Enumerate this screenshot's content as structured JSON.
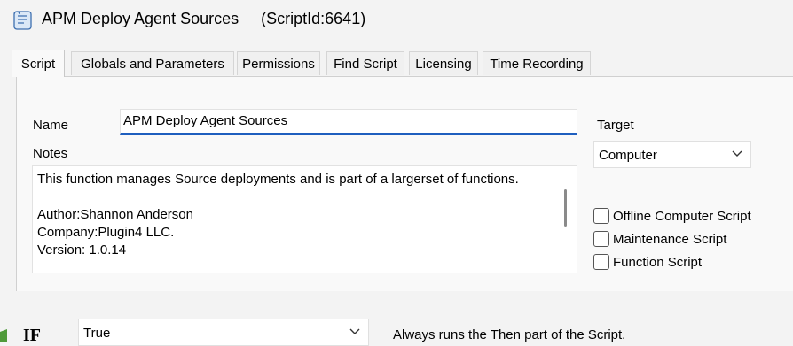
{
  "window": {
    "title": "APM Deploy Agent Sources",
    "script_id": "(ScriptId:6641)",
    "icon": "script-scroll-icon"
  },
  "tabs": [
    {
      "label": "Script",
      "active": true
    },
    {
      "label": "Globals and Parameters"
    },
    {
      "label": "Permissions"
    },
    {
      "label": "Find Script"
    },
    {
      "label": "Licensing"
    },
    {
      "label": "Time Recording"
    }
  ],
  "form": {
    "name_label": "Name",
    "name_value": "APM Deploy Agent Sources",
    "notes_label": "Notes",
    "notes_value": "This function manages Source deployments and is part of a largerset of functions.\n\nAuthor:Shannon Anderson\nCompany:Plugin4 LLC.\nVersion: 1.0.14",
    "target_label": "Target",
    "target_value": "Computer",
    "checkboxes": [
      {
        "label": "Offline Computer Script",
        "checked": false
      },
      {
        "label": "Maintenance Script",
        "checked": false
      },
      {
        "label": "Function Script",
        "checked": false
      }
    ]
  },
  "condition": {
    "if_label": "IF",
    "if_value": "True",
    "description": "Always runs the Then part of the Script."
  },
  "colors": {
    "accent": "#1f5fbf",
    "background": "#f3f3f3",
    "panel": "#f9f9f9"
  }
}
